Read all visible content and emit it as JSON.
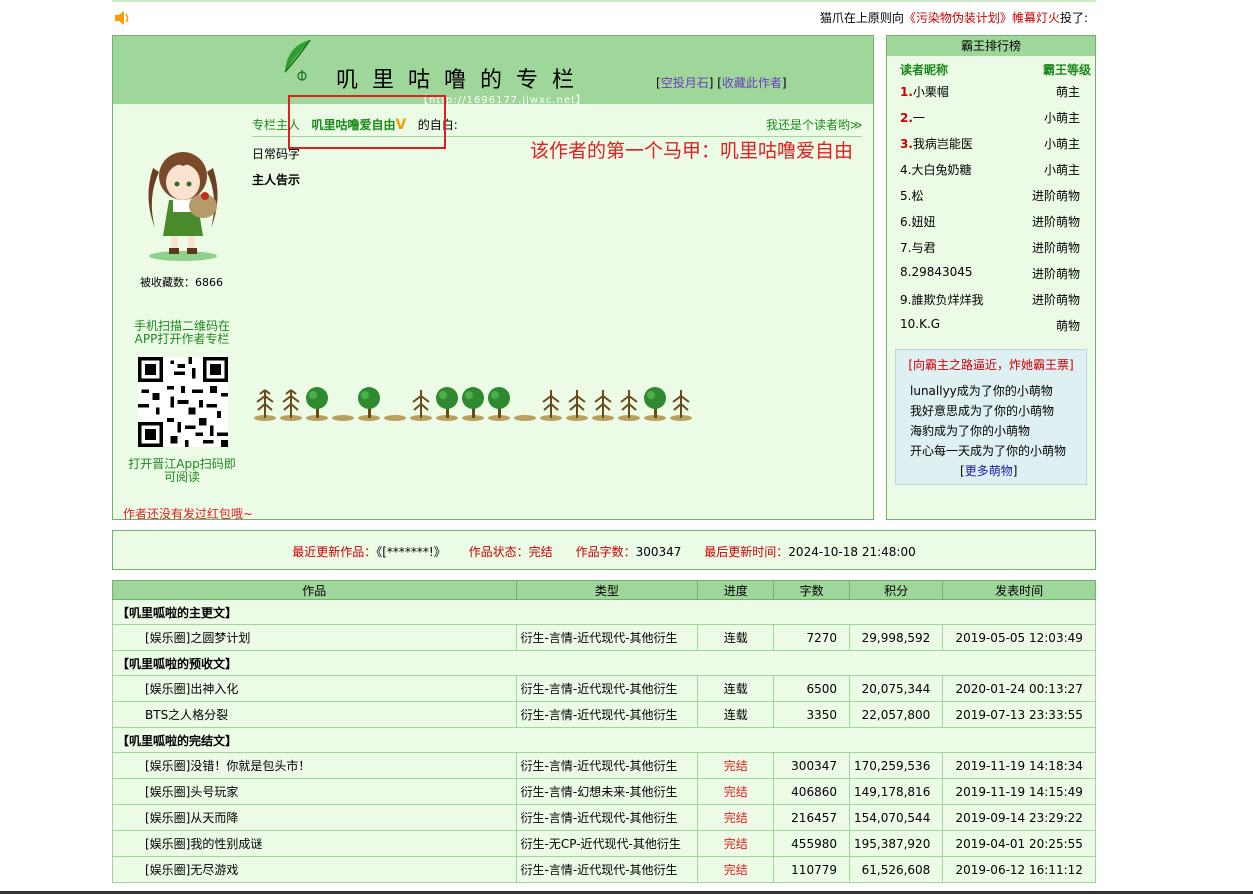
{
  "marquee": {
    "prefix": "猫爪在上原则向",
    "work": "《污染物伪装计划》",
    "suffix_red": "帷幕灯火",
    "suffix": "投了:"
  },
  "header": {
    "title": "叽里咕噜的专栏",
    "link1": "空投月石",
    "link2": "收藏此作者",
    "url": "【http://1696177.jjwxc.net】"
  },
  "owner": {
    "label": "专栏主人",
    "name": "叽里咕噜爱自由",
    "suffix": "的自白:",
    "reader_link": "我还是个读者哟≫",
    "self_text": "日常码字",
    "notice_label": "主人告示"
  },
  "annotation": "该作者的第一个马甲：叽里咕噜爱自由",
  "left": {
    "fav_count": "被收藏数：6866",
    "qr_text1": "手机扫描二维码在APP打开作者专栏",
    "qr_text2": "打开晋江App扫码即可阅读",
    "no_redpack": "作者还没有发过红包哦~"
  },
  "rank": {
    "title": "霸王排行榜",
    "col_name": "读者昵称",
    "col_level": "霸王等级",
    "rows": [
      {
        "num": "1.",
        "name": "小栗帽",
        "level": "萌主",
        "top": true
      },
      {
        "num": "2.",
        "name": "一",
        "level": "小萌主",
        "top": true
      },
      {
        "num": "3.",
        "name": "我病岂能医",
        "level": "小萌主",
        "top": true
      },
      {
        "num": "4.",
        "name": "大白兔奶糖",
        "level": "小萌主",
        "top": false
      },
      {
        "num": "5.",
        "name": "松",
        "level": "进阶萌物",
        "top": false
      },
      {
        "num": "6.",
        "name": "妞妞",
        "level": "进阶萌物",
        "top": false
      },
      {
        "num": "7.",
        "name": "与君",
        "level": "进阶萌物",
        "top": false
      },
      {
        "num": "8.",
        "name": "29843045",
        "level": "进阶萌物",
        "top": false
      },
      {
        "num": "9.",
        "name": "誰欺负烊烊我",
        "level": "进阶萌物",
        "top": false
      },
      {
        "num": "10.",
        "name": "K.G",
        "level": "萌物",
        "top": false
      }
    ],
    "fan_title": "[向霸主之路逼近，炸她霸王票]",
    "fans": [
      "lunallyy成为了你的小萌物",
      "我好意思成为了你的小萌物",
      "海豹成为了你的小萌物",
      "开心每一天成为了你的小萌物"
    ],
    "more": "更多萌物"
  },
  "status": {
    "recent_label": "最近更新作品：",
    "recent_value": "《[*******!》",
    "state_label": "作品状态：",
    "state_value": "完结",
    "words_label": "作品字数：",
    "words_value": "300347",
    "time_label": "最后更新时间：",
    "time_value": "2024-10-18 21:48:00"
  },
  "table": {
    "headers": [
      "作品",
      "类型",
      "进度",
      "字数",
      "积分",
      "发表时间"
    ],
    "sections": [
      {
        "name": "【叽里呱啦的主更文】",
        "rows": [
          [
            "[娱乐圈]之圆梦计划",
            "衍生-言情-近代现代-其他衍生",
            "连载",
            "7270",
            "29,998,592",
            "2019-05-05 12:03:49"
          ]
        ]
      },
      {
        "name": "【叽里呱啦的预收文】",
        "rows": [
          [
            "[娱乐圈]出神入化",
            "衍生-言情-近代现代-其他衍生",
            "连载",
            "6500",
            "20,075,344",
            "2020-01-24 00:13:27"
          ],
          [
            "BTS之人格分裂",
            "衍生-言情-近代现代-其他衍生",
            "连载",
            "3350",
            "22,057,800",
            "2019-07-13 23:33:55"
          ]
        ]
      },
      {
        "name": "【叽里呱啦的完结文】",
        "rows": [
          [
            "[娱乐圈]没错！你就是包头市！",
            "衍生-言情-近代现代-其他衍生",
            "完结",
            "300347",
            "170,259,536",
            "2019-11-19 14:18:34"
          ],
          [
            "[娱乐圈]头号玩家",
            "衍生-言情-幻想未来-其他衍生",
            "完结",
            "406860",
            "149,178,816",
            "2019-11-19 14:15:49"
          ],
          [
            "[娱乐圈]从天而降",
            "衍生-言情-近代现代-其他衍生",
            "完结",
            "216457",
            "154,070,544",
            "2019-09-14 23:29:22"
          ],
          [
            "[娱乐圈]我的性别成谜",
            "衍生-无CP-近代现代-其他衍生",
            "完结",
            "455980",
            "195,387,920",
            "2019-04-01 20:25:55"
          ],
          [
            "[娱乐圈]无尽游戏",
            "衍生-言情-近代现代-其他衍生",
            "完结",
            "110779",
            "61,526,608",
            "2019-06-12 16:11:12"
          ]
        ]
      }
    ]
  }
}
